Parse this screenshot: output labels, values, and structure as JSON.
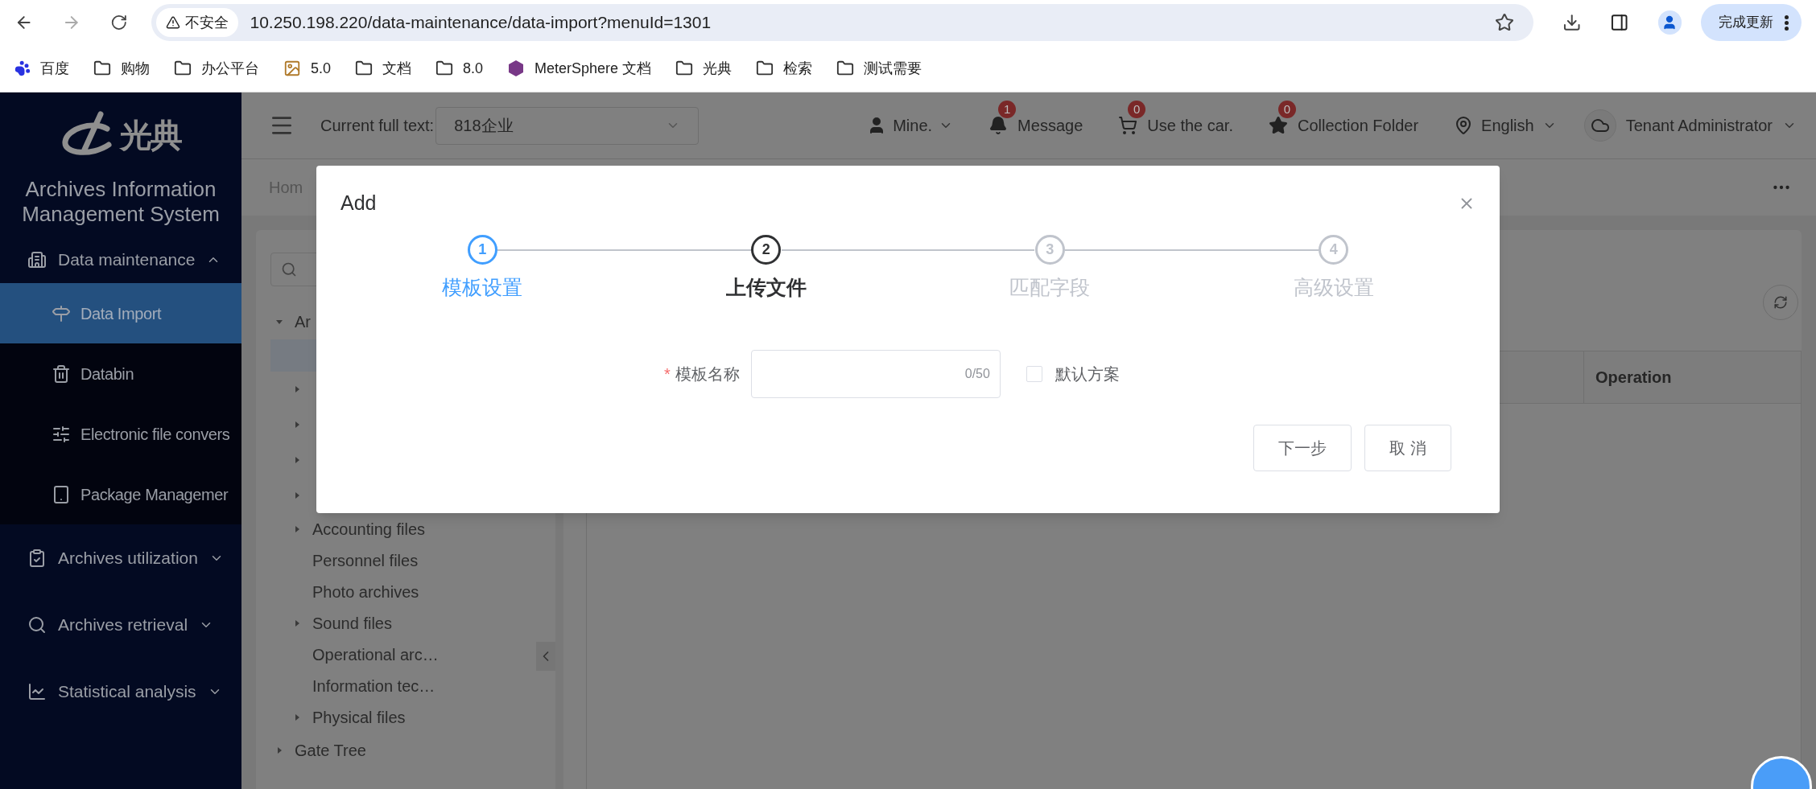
{
  "browser": {
    "security_label": "不安全",
    "url": "10.250.198.220/data-maintenance/data-import?menuId=1301",
    "update_button": "完成更新"
  },
  "bookmarks": [
    {
      "kind": "paw",
      "label": "百度"
    },
    {
      "kind": "folder",
      "label": "购物"
    },
    {
      "kind": "folder",
      "label": "办公平台"
    },
    {
      "kind": "image",
      "label": "5.0"
    },
    {
      "kind": "folder",
      "label": "文档"
    },
    {
      "kind": "folder",
      "label": "8.0"
    },
    {
      "kind": "hexagon",
      "label": "MeterSphere 文档"
    },
    {
      "kind": "folder",
      "label": "光典"
    },
    {
      "kind": "folder",
      "label": "检索"
    },
    {
      "kind": "folder",
      "label": "测试需要"
    }
  ],
  "sidebar": {
    "logo_text": "光典",
    "title": "Archives Information Management System",
    "menu": [
      {
        "label": "Data maintenance",
        "expanded": true,
        "children": [
          {
            "label": "Data Import",
            "selected": true
          },
          {
            "label": "Databin",
            "selected": false
          },
          {
            "label": "Electronic file convers",
            "selected": false
          },
          {
            "label": "Package Managemer",
            "selected": false
          }
        ]
      },
      {
        "label": "Archives utilization",
        "expanded": false
      },
      {
        "label": "Archives retrieval",
        "expanded": false
      },
      {
        "label": "Statistical analysis",
        "expanded": false
      }
    ]
  },
  "header": {
    "current_label": "Current full text:",
    "current_value": "818企业",
    "user": "Mine.",
    "notifications": [
      {
        "label": "Message",
        "count": "1"
      },
      {
        "label": "Use the car.",
        "count": "0"
      },
      {
        "label": "Collection Folder",
        "count": "0"
      }
    ],
    "language": "English",
    "role": "Tenant Administrator"
  },
  "breadcrumb": "Hom",
  "tree": {
    "nodes": [
      {
        "label": "Ar",
        "expanded": true,
        "children": [
          {
            "label": "Accounting files",
            "has_children": true
          },
          {
            "label": "Personnel files",
            "has_children": false
          },
          {
            "label": "Photo archives",
            "has_children": false
          },
          {
            "label": "Sound files",
            "has_children": true
          },
          {
            "label": "Operational arc…",
            "has_children": false
          },
          {
            "label": "Information tec…",
            "has_children": false
          },
          {
            "label": "Physical files",
            "has_children": true
          }
        ]
      },
      {
        "label": "Gate Tree",
        "expanded": false
      }
    ]
  },
  "table": {
    "last_column": "Operation"
  },
  "modal": {
    "title": "Add",
    "steps": [
      {
        "number": "1",
        "label": "模板设置",
        "done": true,
        "active": false
      },
      {
        "number": "2",
        "label": "上传文件",
        "done": false,
        "active": true
      },
      {
        "number": "3",
        "label": "匹配字段",
        "done": false,
        "active": false
      },
      {
        "number": "4",
        "label": "高级设置",
        "done": false,
        "active": false
      }
    ],
    "field": {
      "required_mark": "*",
      "label": "模板名称",
      "counter": "0/50"
    },
    "checkbox": {
      "label": "默认方案",
      "checked": false
    },
    "buttons": [
      {
        "label": "下一步"
      },
      {
        "label": "取 消"
      }
    ]
  }
}
